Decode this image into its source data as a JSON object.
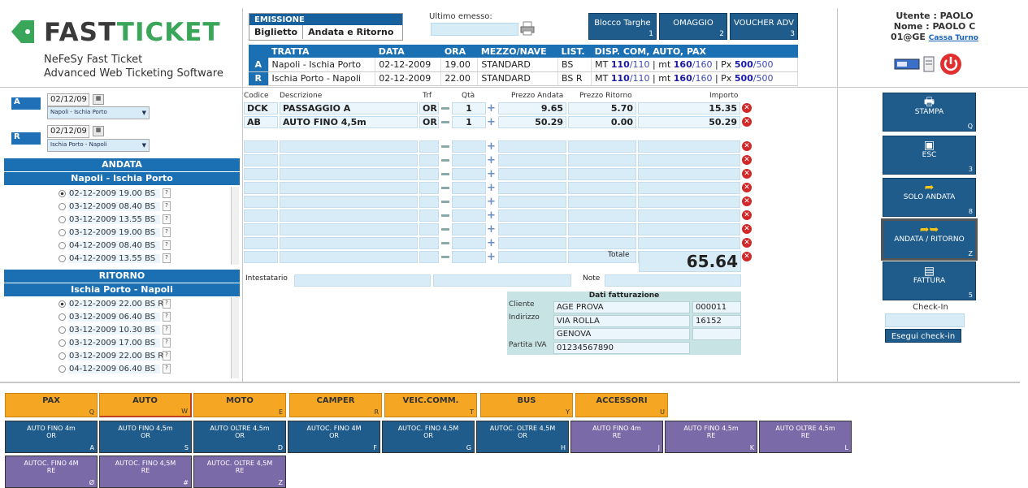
{
  "brand": {
    "fast": "FAST",
    "ticket": "TICKET",
    "line1": "NeFeSy Fast Ticket",
    "line2": "Advanced Web Ticketing Software"
  },
  "emissione": {
    "title": "EMISSIONE",
    "tab1": "Biglietto",
    "tab2": "Andata e Ritorno"
  },
  "ultimo_emesso": "Ultimo emesso:",
  "top_buttons": [
    {
      "label": "Blocco Targhe",
      "key": "1"
    },
    {
      "label": "OMAGGIO",
      "key": "2"
    },
    {
      "label": "VOUCHER ADV",
      "key": "3"
    }
  ],
  "tratta": {
    "headers": [
      "TRATTA",
      "DATA",
      "ORA",
      "MEZZO/NAVE",
      "LIST.",
      "DISP. COM, AUTO, PAX"
    ],
    "rows": [
      {
        "lbl": "A",
        "tratta": "Napoli - Ischia Porto",
        "data": "02-12-2009",
        "ora": "19.00",
        "mezzo": "STANDARD",
        "list": "BS",
        "mt": "110",
        "mt_tot": "110",
        "mt2": "160",
        "mt2_tot": "160",
        "px": "500",
        "px_tot": "500"
      },
      {
        "lbl": "R",
        "tratta": "Ischia Porto - Napoli",
        "data": "02-12-2009",
        "ora": "22.00",
        "mezzo": "STANDARD",
        "list": "BS R",
        "mt": "110",
        "mt_tot": "110",
        "mt2": "160",
        "mt2_tot": "160",
        "px": "500",
        "px_tot": "500"
      }
    ],
    "mt_label": "MT",
    "mt2_label": "mt",
    "px_label": "Px"
  },
  "user": {
    "utente": "Utente : PAOLO",
    "nome": "Nome : PAOLO C",
    "code": "01@GE",
    "cassa": "Cassa Turno"
  },
  "left": {
    "a_label": "A",
    "r_label": "R",
    "a_date": "02/12/09",
    "r_date": "02/12/09",
    "a_route": "Napoli - Ischia Porto",
    "r_route": "Ischia Porto - Napoli",
    "andata_title": "ANDATA",
    "andata_route": "Napoli - Ischia Porto",
    "andata_items": [
      "02-12-2009 19.00 BS",
      "03-12-2009 08.40 BS",
      "03-12-2009 13.55 BS",
      "03-12-2009 19.00 BS",
      "04-12-2009 08.40 BS",
      "04-12-2009 13.55 BS"
    ],
    "ritorno_title": "RITORNO",
    "ritorno_route": "Ischia Porto - Napoli",
    "ritorno_items": [
      "02-12-2009 22.00 BS R",
      "03-12-2009 06.40 BS",
      "03-12-2009 10.30 BS",
      "03-12-2009 17.00 BS",
      "03-12-2009 22.00 BS R",
      "04-12-2009 06.40 BS"
    ]
  },
  "grid": {
    "headers": {
      "codice": "Codice",
      "descrizione": "Descrizione",
      "trf": "Trf",
      "qta": "Qtà",
      "prezzo_andata": "Prezzo Andata",
      "prezzo_ritorno": "Prezzo Ritorno",
      "importo": "Importo"
    },
    "rows": [
      {
        "codice": "DCK",
        "descrizione": "PASSAGGIO A",
        "trf": "OR",
        "qta": "1",
        "pa": "9.65",
        "pr": "5.70",
        "imp": "15.35"
      },
      {
        "codice": "AB",
        "descrizione": "AUTO FINO 4,5m",
        "trf": "OR",
        "qta": "1",
        "pa": "50.29",
        "pr": "0.00",
        "imp": "50.29"
      }
    ],
    "totale_label": "Totale",
    "totale": "65.64",
    "intestatario_label": "Intestatario",
    "note_label": "Note"
  },
  "fatturazione": {
    "title": "Dati fatturazione",
    "cliente_label": "Cliente",
    "cliente": "AGE PROVA",
    "cliente_code": "000011",
    "indirizzo_label": "Indirizzo",
    "indirizzo": "VIA ROLLA",
    "cap": "16152",
    "citta": "GENOVA",
    "piva_label": "Partita IVA",
    "piva": "01234567890"
  },
  "right_buttons": [
    {
      "label": "STAMPA",
      "key": "Q",
      "icon": "printer-icon"
    },
    {
      "label": "ESC",
      "key": "3",
      "icon": "esc-icon"
    },
    {
      "label": "SOLO ANDATA",
      "key": "8",
      "icon": "arrow-icon"
    },
    {
      "label": "ANDATA / RITORNO",
      "key": "Z",
      "icon": "double-arrow-icon"
    },
    {
      "label": "FATTURA",
      "key": "5",
      "icon": "invoice-icon"
    }
  ],
  "checkin": {
    "label": "Check-In",
    "button": "Esegui check-in"
  },
  "vehicle_tabs": [
    {
      "label": "PAX",
      "key": "Q"
    },
    {
      "label": "AUTO",
      "key": "W"
    },
    {
      "label": "MOTO",
      "key": "E"
    },
    {
      "label": "CAMPER",
      "key": "R"
    },
    {
      "label": "VEIC.COMM.",
      "key": "T"
    },
    {
      "label": "BUS",
      "key": "Y"
    },
    {
      "label": "ACCESSORI",
      "key": "U"
    }
  ],
  "tariff_buttons": [
    {
      "l1": "AUTO FINO 4m",
      "l2": "OR",
      "key": "A",
      "kind": "or"
    },
    {
      "l1": "AUTO FINO 4,5m",
      "l2": "OR",
      "key": "S",
      "kind": "or"
    },
    {
      "l1": "AUTO OLTRE 4,5m",
      "l2": "OR",
      "key": "D",
      "kind": "or"
    },
    {
      "l1": "AUTOC. FINO 4M",
      "l2": "OR",
      "key": "F",
      "kind": "or"
    },
    {
      "l1": "AUTOC. FINO 4,5M",
      "l2": "OR",
      "key": "G",
      "kind": "or"
    },
    {
      "l1": "AUTOC. OLTRE 4,5M",
      "l2": "OR",
      "key": "H",
      "kind": "or"
    },
    {
      "l1": "AUTO FINO 4m",
      "l2": "RE",
      "key": "J",
      "kind": "re"
    },
    {
      "l1": "AUTO FINO 4,5m",
      "l2": "RE",
      "key": "K",
      "kind": "re"
    },
    {
      "l1": "AUTO OLTRE 4,5m",
      "l2": "RE",
      "key": "L",
      "kind": "re"
    },
    {
      "l1": "AUTOC. FINO 4M",
      "l2": "RE",
      "key": "Ø",
      "kind": "re"
    },
    {
      "l1": "AUTOC. FINO 4,5M",
      "l2": "RE",
      "key": "#",
      "kind": "re"
    },
    {
      "l1": "AUTOC. OLTRE 4,5M",
      "l2": "RE",
      "key": "Z",
      "kind": "re"
    }
  ]
}
